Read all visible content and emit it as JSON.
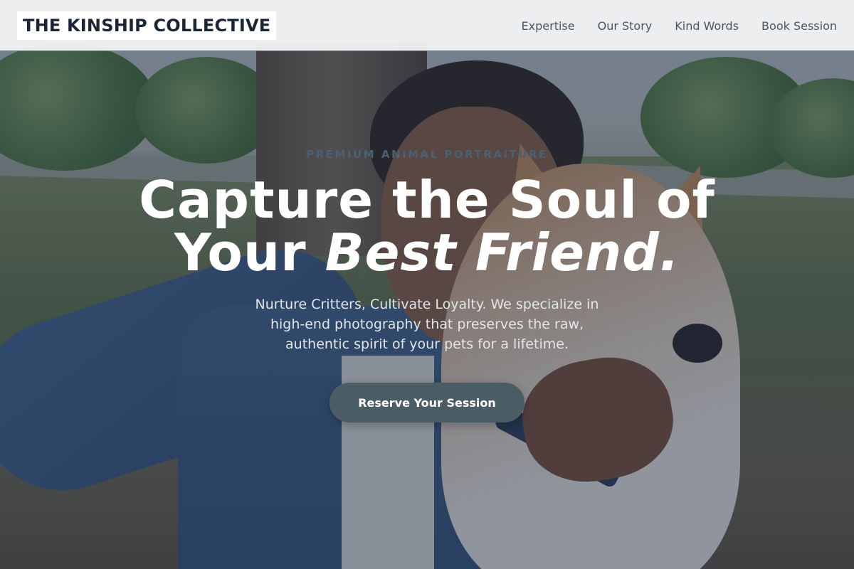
{
  "header": {
    "brand": "THE KINSHIP COLLECTIVE",
    "nav": [
      "Expertise",
      "Our Story",
      "Kind Words",
      "Book Session"
    ]
  },
  "hero": {
    "eyebrow": "PREMIUM ANIMAL PORTRAITURE",
    "headline_line1": "Capture the Soul of",
    "headline_line2_plain": "Your ",
    "headline_line2_em": "Best Friend.",
    "subtext": "Nurture Critters, Cultivate Loyalty. We specialize in high-end photography that preserves the raw, authentic spirit of your pets for a lifetime.",
    "cta_label": "Reserve Your Session",
    "background_image": "photo of a smiling person hugging a shiba inu dog in a park"
  },
  "colors": {
    "header_bg": "#f4f5f7",
    "brand_text": "#1c2536",
    "nav_text": "#4c5564",
    "overlay": "#24324b",
    "eyebrow": "#4b6072",
    "cta_bg": "#4c5c65"
  }
}
